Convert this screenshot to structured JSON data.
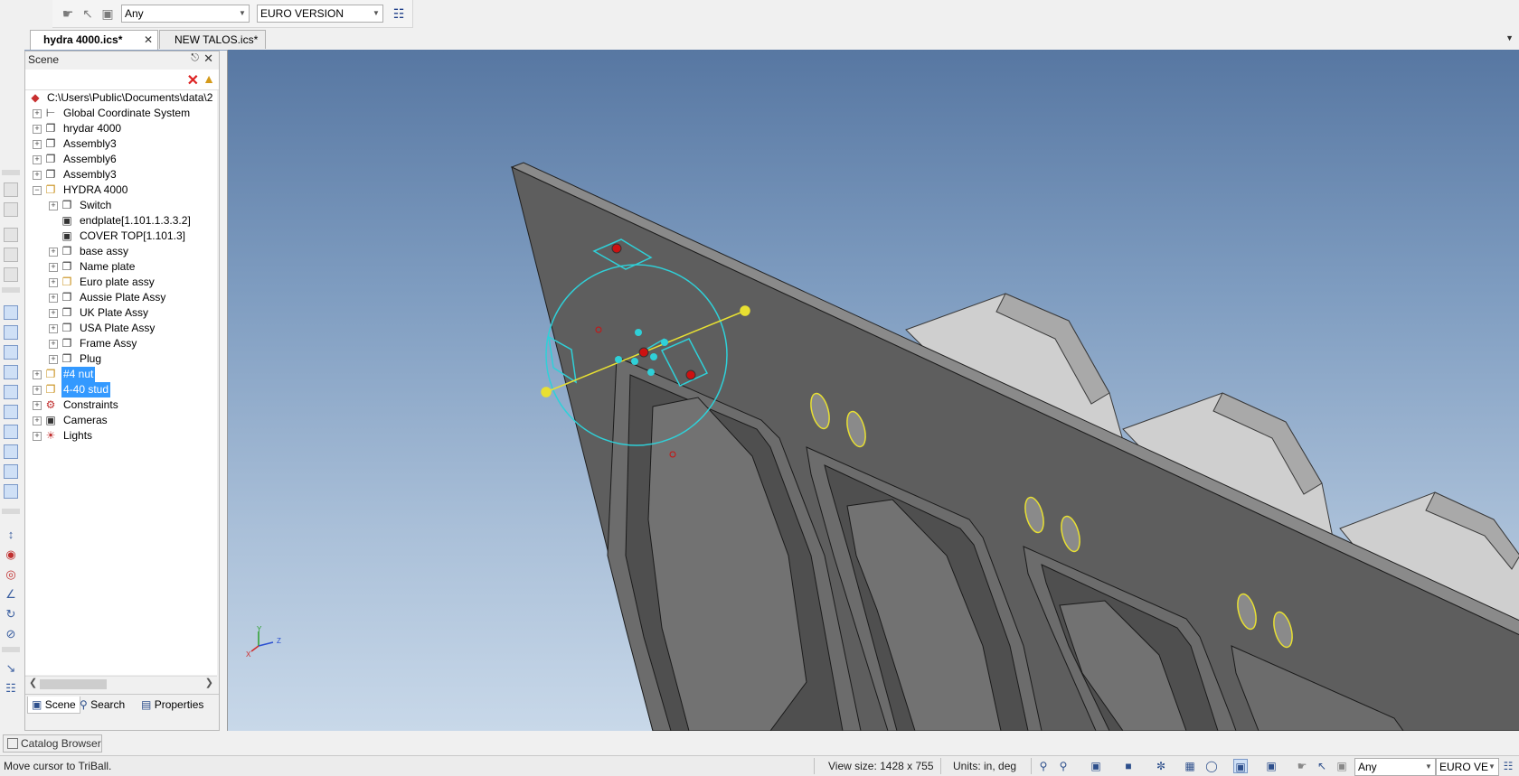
{
  "toolbar": {
    "filter_value": "Any",
    "version_value": "EURO VERSION"
  },
  "tabs": [
    {
      "label": "hydra 4000.ics*",
      "active": true
    },
    {
      "label": "NEW TALOS.ics*",
      "active": false
    }
  ],
  "scene": {
    "title": "Scene",
    "root_path": "C:\\Users\\Public\\Documents\\data\\2",
    "items": [
      {
        "label": "Global Coordinate System",
        "icon": "axes-icon"
      },
      {
        "label": "hrydar 4000",
        "icon": "assembly-icon"
      },
      {
        "label": "Assembly3",
        "icon": "assembly-icon"
      },
      {
        "label": "Assembly6",
        "icon": "assembly-icon"
      },
      {
        "label": "Assembly3",
        "icon": "assembly-icon"
      },
      {
        "label": "HYDRA 4000",
        "icon": "assembly-colored-icon"
      },
      {
        "label": "Switch",
        "icon": "assembly-icon"
      },
      {
        "label": "endplate[1.101.1.3.3.2]",
        "icon": "part-icon"
      },
      {
        "label": "COVER TOP[1.101.3]",
        "icon": "part-icon"
      },
      {
        "label": "base assy",
        "icon": "assembly-icon"
      },
      {
        "label": "Name plate",
        "icon": "assembly-icon"
      },
      {
        "label": "Euro plate assy",
        "icon": "assembly-colored-icon"
      },
      {
        "label": "Aussie Plate Assy",
        "icon": "assembly-icon"
      },
      {
        "label": "UK Plate Assy",
        "icon": "assembly-icon"
      },
      {
        "label": "USA Plate Assy",
        "icon": "assembly-icon"
      },
      {
        "label": "Frame Assy",
        "icon": "assembly-icon"
      },
      {
        "label": "Plug",
        "icon": "assembly-icon"
      },
      {
        "label": "#4 nut",
        "icon": "assembly-colored-icon"
      },
      {
        "label": "4-40 stud",
        "icon": "assembly-colored-icon"
      },
      {
        "label": "Constraints",
        "icon": "constraints-icon"
      },
      {
        "label": "Cameras",
        "icon": "camera-icon"
      },
      {
        "label": "Lights",
        "icon": "light-icon"
      }
    ],
    "panel_tabs": [
      "Scene",
      "Search",
      "Properties"
    ]
  },
  "viewport": {
    "axis_y": "Y",
    "axis_x": "X",
    "axis_z": "Z"
  },
  "catalog_browser": "Catalog Browser",
  "status": {
    "message": "Move cursor to TriBall.",
    "view_size": "View size: 1428 x  755",
    "units": "Units: in, deg",
    "filter_value": "Any",
    "version_value": "EURO VE"
  },
  "colors": {
    "selection": "#3399ff",
    "triball": "#2fd0d8",
    "highlight": "#e8e032"
  }
}
